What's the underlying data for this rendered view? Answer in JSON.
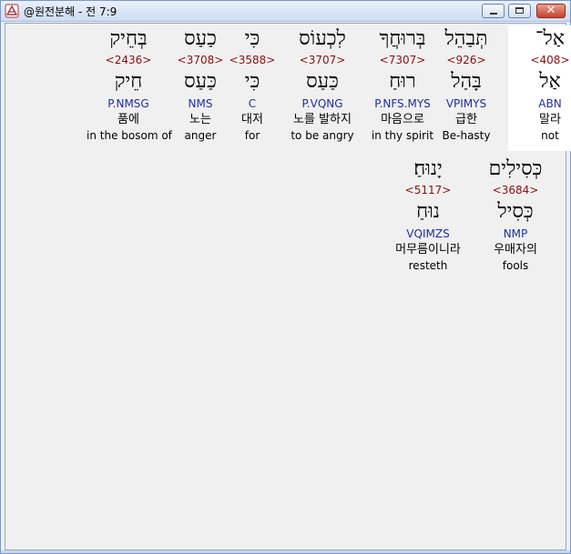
{
  "window": {
    "title": "@원전분해 - 전 7:9"
  },
  "colors": {
    "strong": "#8a1010",
    "morph": "#1d2fa0",
    "highlight": "#ffffff"
  },
  "words": [
    {
      "heb": "אַל־",
      "strong": "<408>",
      "lemma": "אַל",
      "morph": "ABN",
      "kor": "말라",
      "eng": "not",
      "highlighted": true
    },
    {
      "heb": "תְּבַהֵל",
      "strong": "<926>",
      "lemma": "בָּהַל",
      "morph": "VPIMYS",
      "kor": "급한",
      "eng": "Be-hasty",
      "highlighted": false
    },
    {
      "heb": "בְּרוּחֲךָ",
      "strong": "<7307>",
      "lemma": "רוּחַ",
      "morph": "P.NFS.MYS",
      "kor": "마음으로",
      "eng": "in thy spirit",
      "highlighted": false
    },
    {
      "heb": "לִכְעוֹס",
      "strong": "<3707>",
      "lemma": "כַּעַס",
      "morph": "P.VQNG",
      "kor": "노를 발하지",
      "eng": "to be angry",
      "highlighted": false
    },
    {
      "heb": "כִּי",
      "strong": "<3588>",
      "lemma": "כִּי",
      "morph": "C",
      "kor": "대저",
      "eng": "for",
      "highlighted": false
    },
    {
      "heb": "כַעַס",
      "strong": "<3708>",
      "lemma": "כַּעַס",
      "morph": "NMS",
      "kor": "노는",
      "eng": "anger",
      "highlighted": false
    },
    {
      "heb": "בְּחֵיק",
      "strong": "<2436>",
      "lemma": "חֵיק",
      "morph": "P.NMSG",
      "kor": "품에",
      "eng": "in the bosom of",
      "highlighted": false
    },
    {
      "heb": "כְּסִילִים",
      "strong": "<3684>",
      "lemma": "כְּסִיל",
      "morph": "NMP",
      "kor": "우매자의",
      "eng": "fools",
      "highlighted": false
    },
    {
      "heb": "יָנוּחַ׃",
      "strong": "<5117>",
      "lemma": "נוּחַ",
      "morph": "VQIMZS",
      "kor": "머무름이니라",
      "eng": "resteth",
      "highlighted": false
    }
  ]
}
